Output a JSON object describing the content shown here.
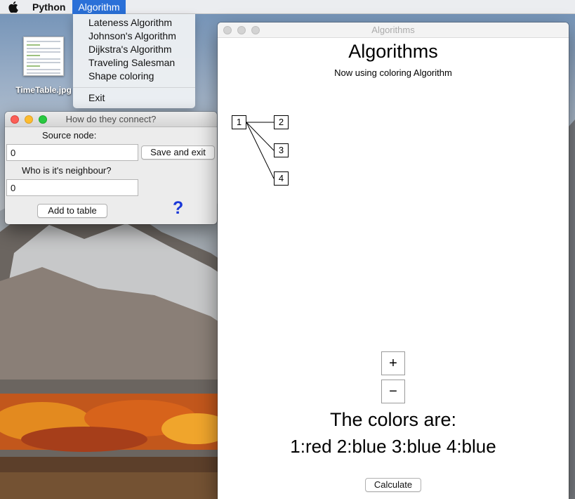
{
  "menubar": {
    "apple_icon": "apple-logo-icon",
    "app_name": "Python",
    "active_menu": "Algorithm"
  },
  "algorithm_menu": {
    "items": [
      "Lateness Algorithm",
      "Johnson's Algorithm",
      "Dijkstra's Algorithm",
      "Traveling Salesman",
      "Shape coloring"
    ],
    "exit": "Exit"
  },
  "desktop": {
    "file_label": "TimeTable.jpg"
  },
  "connect_dialog": {
    "title": "How do they connect?",
    "source_label": "Source node:",
    "source_value": "0",
    "save_exit": "Save and exit",
    "neighbour_label": "Who is it's neighbour?",
    "neighbour_value": "0",
    "add_to_table": "Add to table",
    "help": "?",
    "help_color": "#1a38d8"
  },
  "main_window": {
    "window_title": "Algorithms",
    "heading": "Algorithms",
    "subtitle": "Now using coloring Algorithm",
    "graph": {
      "nodes": [
        "1",
        "2",
        "3",
        "4"
      ],
      "edges": [
        [
          "1",
          "2"
        ],
        [
          "1",
          "3"
        ],
        [
          "1",
          "4"
        ]
      ]
    },
    "zoom_in": "+",
    "zoom_out": "−",
    "colors_title": "The colors are:",
    "colors_values": "1:red 2:blue 3:blue 4:blue",
    "calculate": "Calculate"
  }
}
